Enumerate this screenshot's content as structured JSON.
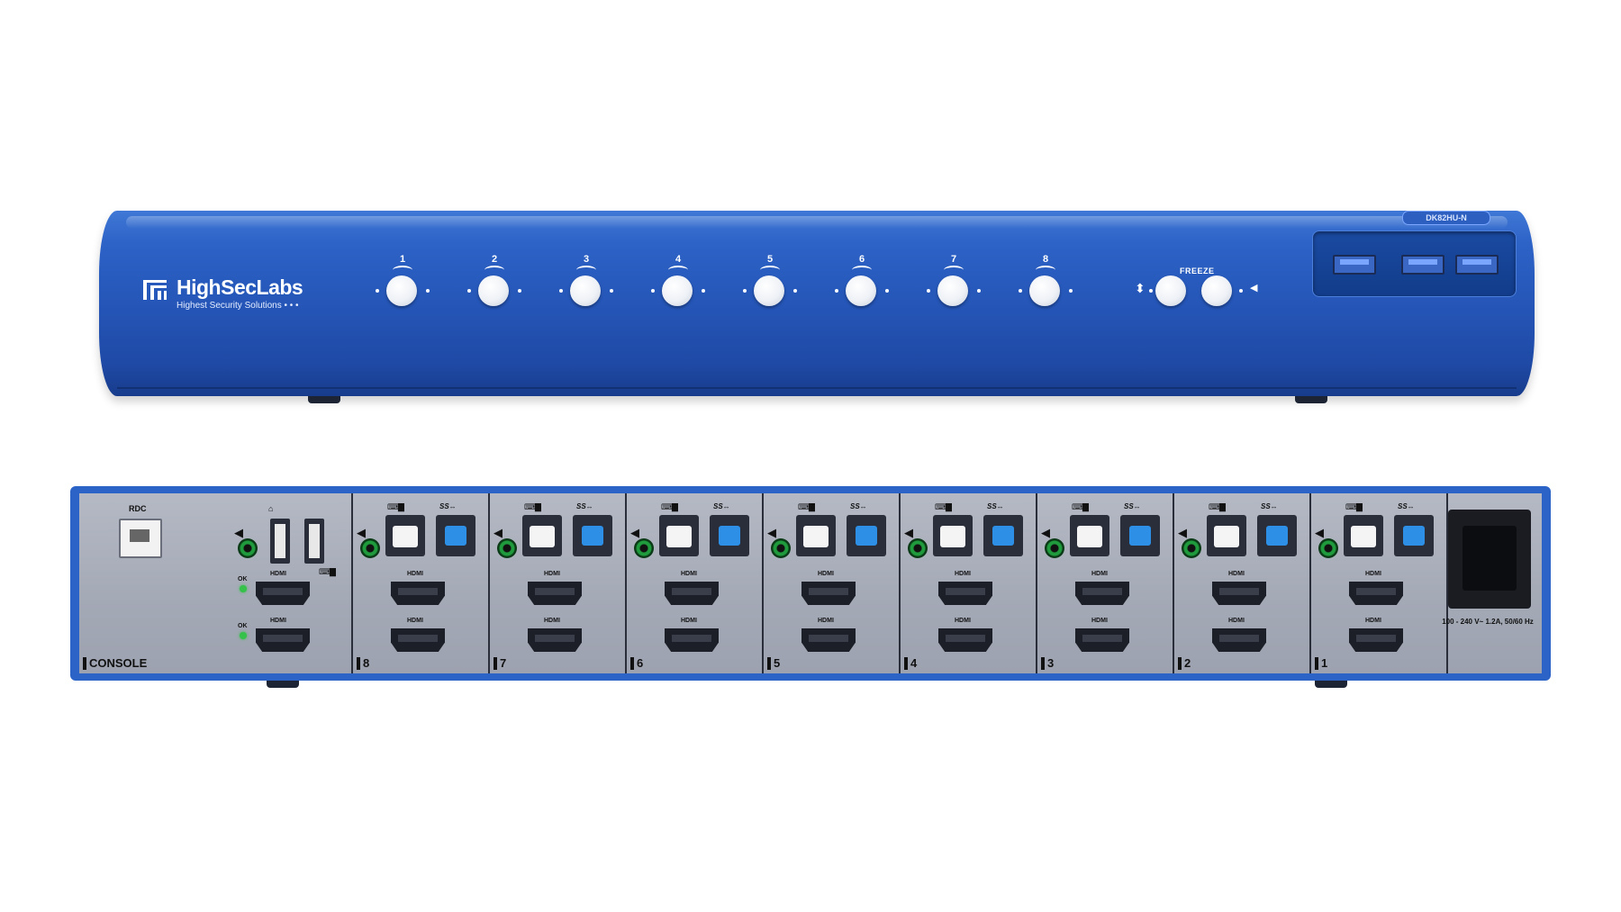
{
  "front_panel": {
    "brand": "HighSecLabs",
    "tagline": "Highest Security Solutions • • •",
    "model": "DK82HU-N",
    "ports": [
      "1",
      "2",
      "3",
      "4",
      "5",
      "6",
      "7",
      "8"
    ],
    "freeze_label": "FREEZE",
    "usb_symbol": "⬍",
    "audio_symbol": "◀"
  },
  "rear_panel": {
    "console_label": "CONSOLE",
    "rdc_label": "RDC",
    "ok_label": "OK",
    "hdmi_label": "HDMI",
    "ss_label": "SS↔",
    "kb_label": "⌨▇",
    "channels": [
      "8",
      "7",
      "6",
      "5",
      "4",
      "3",
      "2",
      "1"
    ],
    "power_label": "100 - 240 V~ 1.2A, 50/60 Hz"
  },
  "colors": {
    "chassis_blue": "#2556b8",
    "rear_plate": "#a4a9b6",
    "audio_green": "#1f9a3c",
    "usb3_blue": "#2d8fe6"
  }
}
